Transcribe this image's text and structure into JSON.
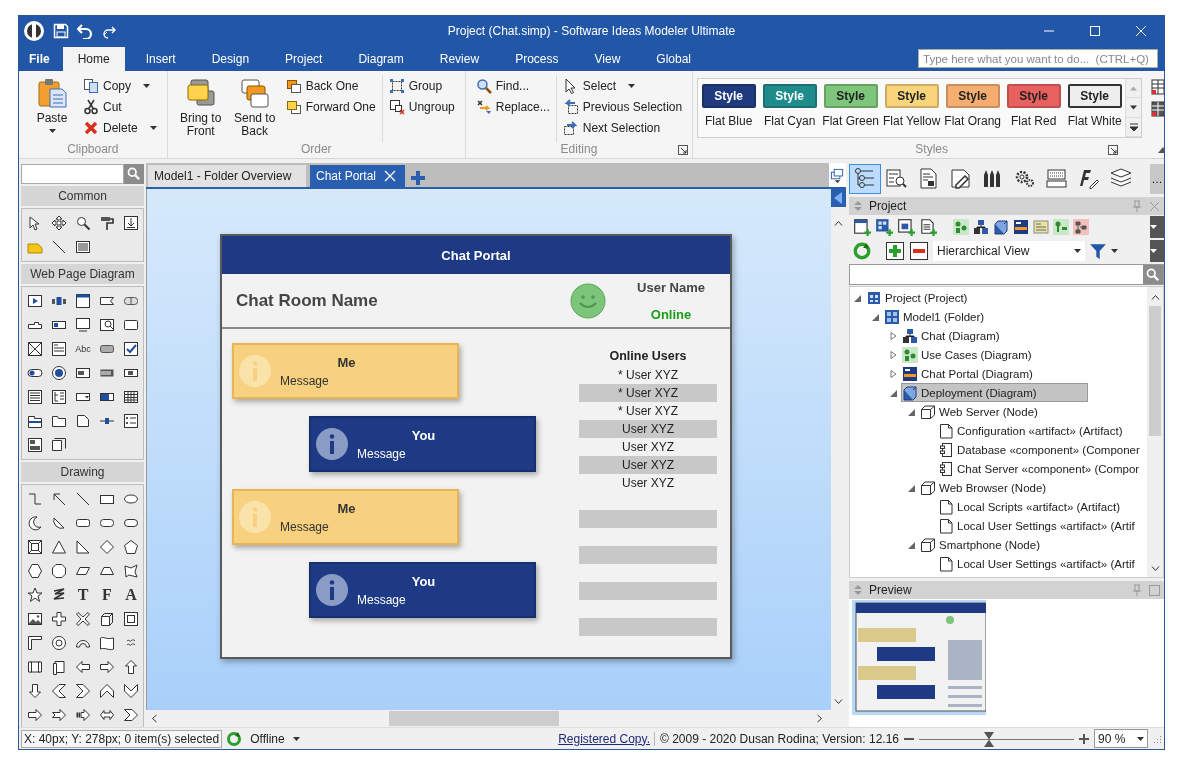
{
  "window": {
    "title": "Project (Chat.simp) - Software Ideas Modeler Ultimate"
  },
  "ribbon_tabs": [
    {
      "label": "File",
      "kind": "file",
      "selected": false
    },
    {
      "label": "Home",
      "kind": "tab",
      "selected": true
    },
    {
      "label": "Insert",
      "kind": "tab",
      "selected": false
    },
    {
      "label": "Design",
      "kind": "tab",
      "selected": false
    },
    {
      "label": "Project",
      "kind": "tab",
      "selected": false
    },
    {
      "label": "Diagram",
      "kind": "tab",
      "selected": false
    },
    {
      "label": "Review",
      "kind": "tab",
      "selected": false
    },
    {
      "label": "Process",
      "kind": "tab",
      "selected": false
    },
    {
      "label": "View",
      "kind": "tab",
      "selected": false
    },
    {
      "label": "Global",
      "kind": "tab",
      "selected": false
    }
  ],
  "command_search": {
    "placeholder": "Type here what you want to do...  (CTRL+Q)"
  },
  "ribbon_groups": [
    {
      "label": "Clipboard",
      "launcher": false,
      "sections": [
        [
          [
            {
              "label": "Paste",
              "kind": "large",
              "dropdown": true
            }
          ],
          [
            {
              "label": "Copy",
              "kind": "small",
              "dropdown": true
            },
            {
              "label": "Cut",
              "kind": "small",
              "dropdown": false
            },
            {
              "label": "Delete",
              "kind": "small",
              "dropdown": true
            }
          ]
        ]
      ]
    },
    {
      "label": "Order",
      "launcher": false,
      "sections": [
        [
          [
            {
              "label": "Bring to Front",
              "kind": "large",
              "dropdown": false
            }
          ],
          [
            {
              "label": "Send to Back",
              "kind": "large",
              "dropdown": false
            }
          ],
          [
            {
              "label": "Back One",
              "kind": "small",
              "dropdown": false
            },
            {
              "label": "Forward One",
              "kind": "small",
              "dropdown": false
            }
          ]
        ],
        [
          [
            {
              "label": "Group",
              "kind": "small",
              "dropdown": false
            },
            {
              "label": "Ungroup",
              "kind": "small",
              "dropdown": false
            }
          ]
        ]
      ]
    },
    {
      "label": "Editing",
      "launcher": true,
      "sections": [
        [
          [
            {
              "label": "Find...",
              "kind": "small",
              "dropdown": false
            },
            {
              "label": "Replace...",
              "kind": "small",
              "dropdown": false
            }
          ]
        ],
        [
          [
            {
              "label": "Select",
              "kind": "small",
              "dropdown": true
            },
            {
              "label": "Previous Selection",
              "kind": "small",
              "dropdown": false
            },
            {
              "label": "Next Selection",
              "kind": "small",
              "dropdown": false
            }
          ]
        ]
      ]
    }
  ],
  "styles": {
    "label": "Styles",
    "items": [
      {
        "sample": "Style",
        "name": "Flat Blue",
        "color": "#1f3b7f"
      },
      {
        "sample": "Style",
        "name": "Flat Cyan",
        "color": "#1f8b8b"
      },
      {
        "sample": "Style",
        "name": "Flat Green",
        "color": "#7dc67b"
      },
      {
        "sample": "Style",
        "name": "Flat Yellow",
        "color": "#f8d47a"
      },
      {
        "sample": "Style",
        "name": "Flat Orang",
        "color": "#f5ad70"
      },
      {
        "sample": "Style",
        "name": "Flat Red",
        "color": "#e8615f"
      },
      {
        "sample": "Style",
        "name": "Flat White",
        "color": "#eeeeee"
      }
    ]
  },
  "toolbox": {
    "sections": [
      {
        "title": "Common"
      },
      {
        "title": "Web Page Diagram",
        "glyphs": [
          "Abc"
        ]
      },
      {
        "title": "Drawing",
        "glyphs": [
          "T",
          "F",
          "A"
        ]
      }
    ]
  },
  "document_tabs": [
    {
      "label": "Model1 - Folder Overview",
      "selected": false
    },
    {
      "label": "Chat Portal",
      "selected": true
    }
  ],
  "diagram": {
    "title": "Chat Portal",
    "room_name": "Chat Room Name",
    "user_name": "User Name",
    "status": "Online",
    "messages": [
      {
        "kind": "me",
        "sender": "Me",
        "text": "Message"
      },
      {
        "kind": "you",
        "sender": "You",
        "text": "Message"
      },
      {
        "kind": "me",
        "sender": "Me",
        "text": "Message"
      },
      {
        "kind": "you",
        "sender": "You",
        "text": "Message"
      }
    ],
    "online_users": {
      "title": "Online Users",
      "users": [
        "* User XYZ",
        "* User XYZ",
        "* User XYZ",
        "User XYZ",
        "User XYZ",
        "User XYZ",
        "User XYZ"
      ]
    }
  },
  "panel_toolbar": {
    "overflow": "…"
  },
  "project_panel": {
    "title": "Project",
    "view": "Hierarchical View",
    "tree": [
      {
        "label": "Project (Project)",
        "kind": "project",
        "expanded": true,
        "selected": false,
        "children": [
          {
            "label": "Model1 (Folder)",
            "kind": "folder",
            "expanded": true,
            "selected": false,
            "children": [
              {
                "label": "Chat (Diagram)",
                "kind": "class-diagram",
                "expanded": false,
                "selected": false
              },
              {
                "label": "Use Cases (Diagram)",
                "kind": "usecase-diagram",
                "expanded": false,
                "selected": false
              },
              {
                "label": "Chat Portal (Diagram)",
                "kind": "webpage-diagram",
                "expanded": false,
                "selected": false
              },
              {
                "label": "Deployment (Diagram)",
                "kind": "deployment-diagram",
                "expanded": true,
                "selected": true,
                "children": [
                  {
                    "label": "Web Server (Node)",
                    "kind": "node",
                    "expanded": true,
                    "selected": false,
                    "children": [
                      {
                        "label": "Configuration «artifact» (Artifact)",
                        "kind": "artifact",
                        "selected": false
                      },
                      {
                        "label": "Database «component» (Componer",
                        "kind": "component",
                        "selected": false
                      },
                      {
                        "label": "Chat Server «component» (Compor",
                        "kind": "component",
                        "selected": false
                      }
                    ]
                  },
                  {
                    "label": "Web Browser (Node)",
                    "kind": "node",
                    "expanded": true,
                    "selected": false,
                    "children": [
                      {
                        "label": "Local Scripts «artifact» (Artifact)",
                        "kind": "artifact",
                        "selected": false
                      },
                      {
                        "label": "Local User Settings «artifact» (Artif",
                        "kind": "artifact",
                        "selected": false
                      }
                    ]
                  },
                  {
                    "label": "Smartphone (Node)",
                    "kind": "node",
                    "expanded": true,
                    "selected": false,
                    "children": [
                      {
                        "label": "Local User Settings «artifact» (Artif",
                        "kind": "artifact",
                        "selected": false
                      }
                    ]
                  }
                ]
              }
            ]
          }
        ]
      }
    ]
  },
  "preview_panel": {
    "title": "Preview"
  },
  "status_bar": {
    "position": "X: 40px; Y: 278px; 0 item(s) selected",
    "connection": "Offline",
    "license_link": "Registered Copy.",
    "copyright": "© 2009 - 2020 Dusan Rodina; Version: 12.16",
    "zoom": {
      "level": 0.45,
      "value": "90 %"
    }
  }
}
